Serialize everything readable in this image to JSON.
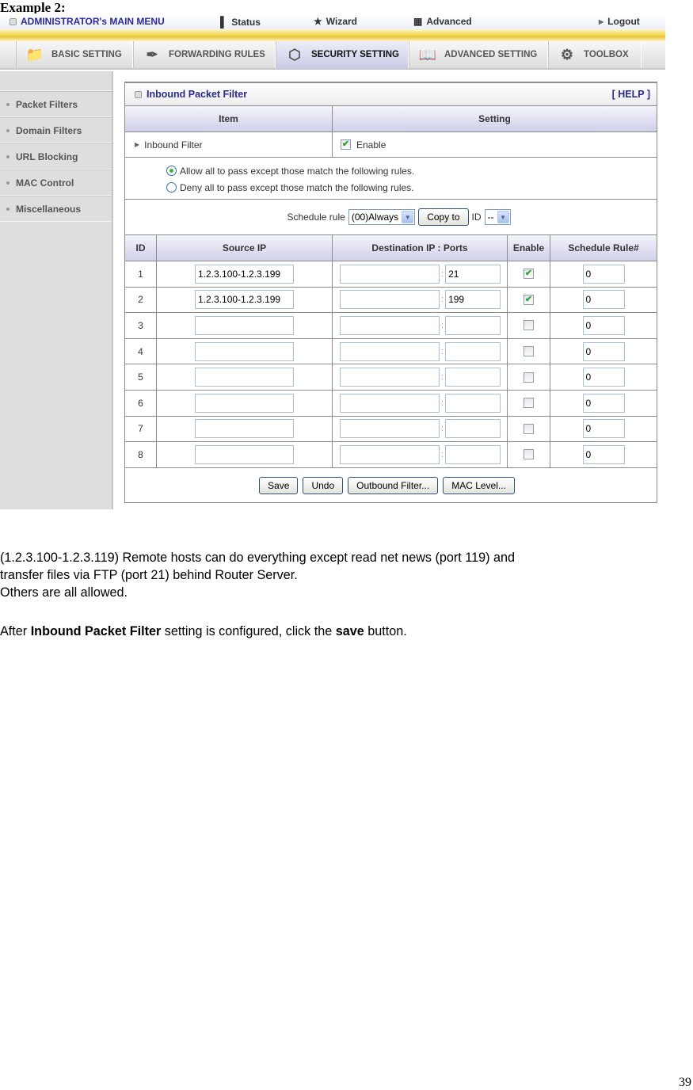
{
  "doc": {
    "example_title": "Example 2:",
    "paragraph1_line1": "(1.2.3.100-1.2.3.119) Remote hosts can do everything except read net news (port 119) and",
    "paragraph1_line2": "transfer files via FTP (port 21) behind Router Server.",
    "paragraph1_line3": "Others are all allowed.",
    "paragraph2": {
      "prefix": "After ",
      "bold1": "Inbound Packet Filter",
      "middle": " setting is configured, click the ",
      "bold2": "save",
      "suffix": " button."
    },
    "page_number": "39"
  },
  "topmenu": {
    "admin": "ADMINISTRATOR's MAIN MENU",
    "status": "Status",
    "wizard": "Wizard",
    "advanced": "Advanced",
    "logout": "Logout"
  },
  "tabs": [
    {
      "label": "BASIC SETTING",
      "icon": "folder-icon"
    },
    {
      "label": "FORWARDING RULES",
      "icon": "forwarding-icon"
    },
    {
      "label": "SECURITY SETTING",
      "icon": "security-nut-icon",
      "active": true
    },
    {
      "label": "ADVANCED SETTING",
      "icon": "advanced-book-icon"
    },
    {
      "label": "TOOLBOX",
      "icon": "toolbox-gear-icon"
    }
  ],
  "sidebar": {
    "items": [
      {
        "label": "Packet Filters"
      },
      {
        "label": "Domain Filters"
      },
      {
        "label": "URL Blocking"
      },
      {
        "label": "MAC Control"
      },
      {
        "label": "Miscellaneous"
      }
    ]
  },
  "panel": {
    "title": "Inbound Packet Filter",
    "help": "[ HELP ]",
    "col_item": "Item",
    "col_setting": "Setting",
    "inbound_filter_label": "Inbound Filter",
    "enable_label": "Enable",
    "enable_checked": true,
    "radio_allow": "Allow all to pass except those match the following rules.",
    "radio_deny": "Deny all to pass except those match the following rules.",
    "radio_selected": "allow",
    "schedule_label": "Schedule rule",
    "schedule_value": "(00)Always",
    "copy_to": "Copy to",
    "id_label": "ID",
    "id_value": "--",
    "columns": [
      "ID",
      "Source IP",
      "Destination IP : Ports",
      "Enable",
      "Schedule Rule#"
    ],
    "rows": [
      {
        "id": "1",
        "source_ip": "1.2.3.100-1.2.3.199",
        "dest_ip": "",
        "port": "21",
        "enabled": true,
        "schedule": "0"
      },
      {
        "id": "2",
        "source_ip": "1.2.3.100-1.2.3.199",
        "dest_ip": "",
        "port": "199",
        "enabled": true,
        "schedule": "0"
      },
      {
        "id": "3",
        "source_ip": "",
        "dest_ip": "",
        "port": "",
        "enabled": false,
        "schedule": "0"
      },
      {
        "id": "4",
        "source_ip": "",
        "dest_ip": "",
        "port": "",
        "enabled": false,
        "schedule": "0"
      },
      {
        "id": "5",
        "source_ip": "",
        "dest_ip": "",
        "port": "",
        "enabled": false,
        "schedule": "0"
      },
      {
        "id": "6",
        "source_ip": "",
        "dest_ip": "",
        "port": "",
        "enabled": false,
        "schedule": "0"
      },
      {
        "id": "7",
        "source_ip": "",
        "dest_ip": "",
        "port": "",
        "enabled": false,
        "schedule": "0"
      },
      {
        "id": "8",
        "source_ip": "",
        "dest_ip": "",
        "port": "",
        "enabled": false,
        "schedule": "0"
      }
    ],
    "buttons": {
      "save": "Save",
      "undo": "Undo",
      "outbound": "Outbound Filter...",
      "mac_level": "MAC Level..."
    }
  },
  "colors": {
    "title_blue": "#2a2a8a",
    "gold_bar": "#f1d34c",
    "active_tab": "#c9cbe7",
    "check_green": "#27a33a"
  }
}
